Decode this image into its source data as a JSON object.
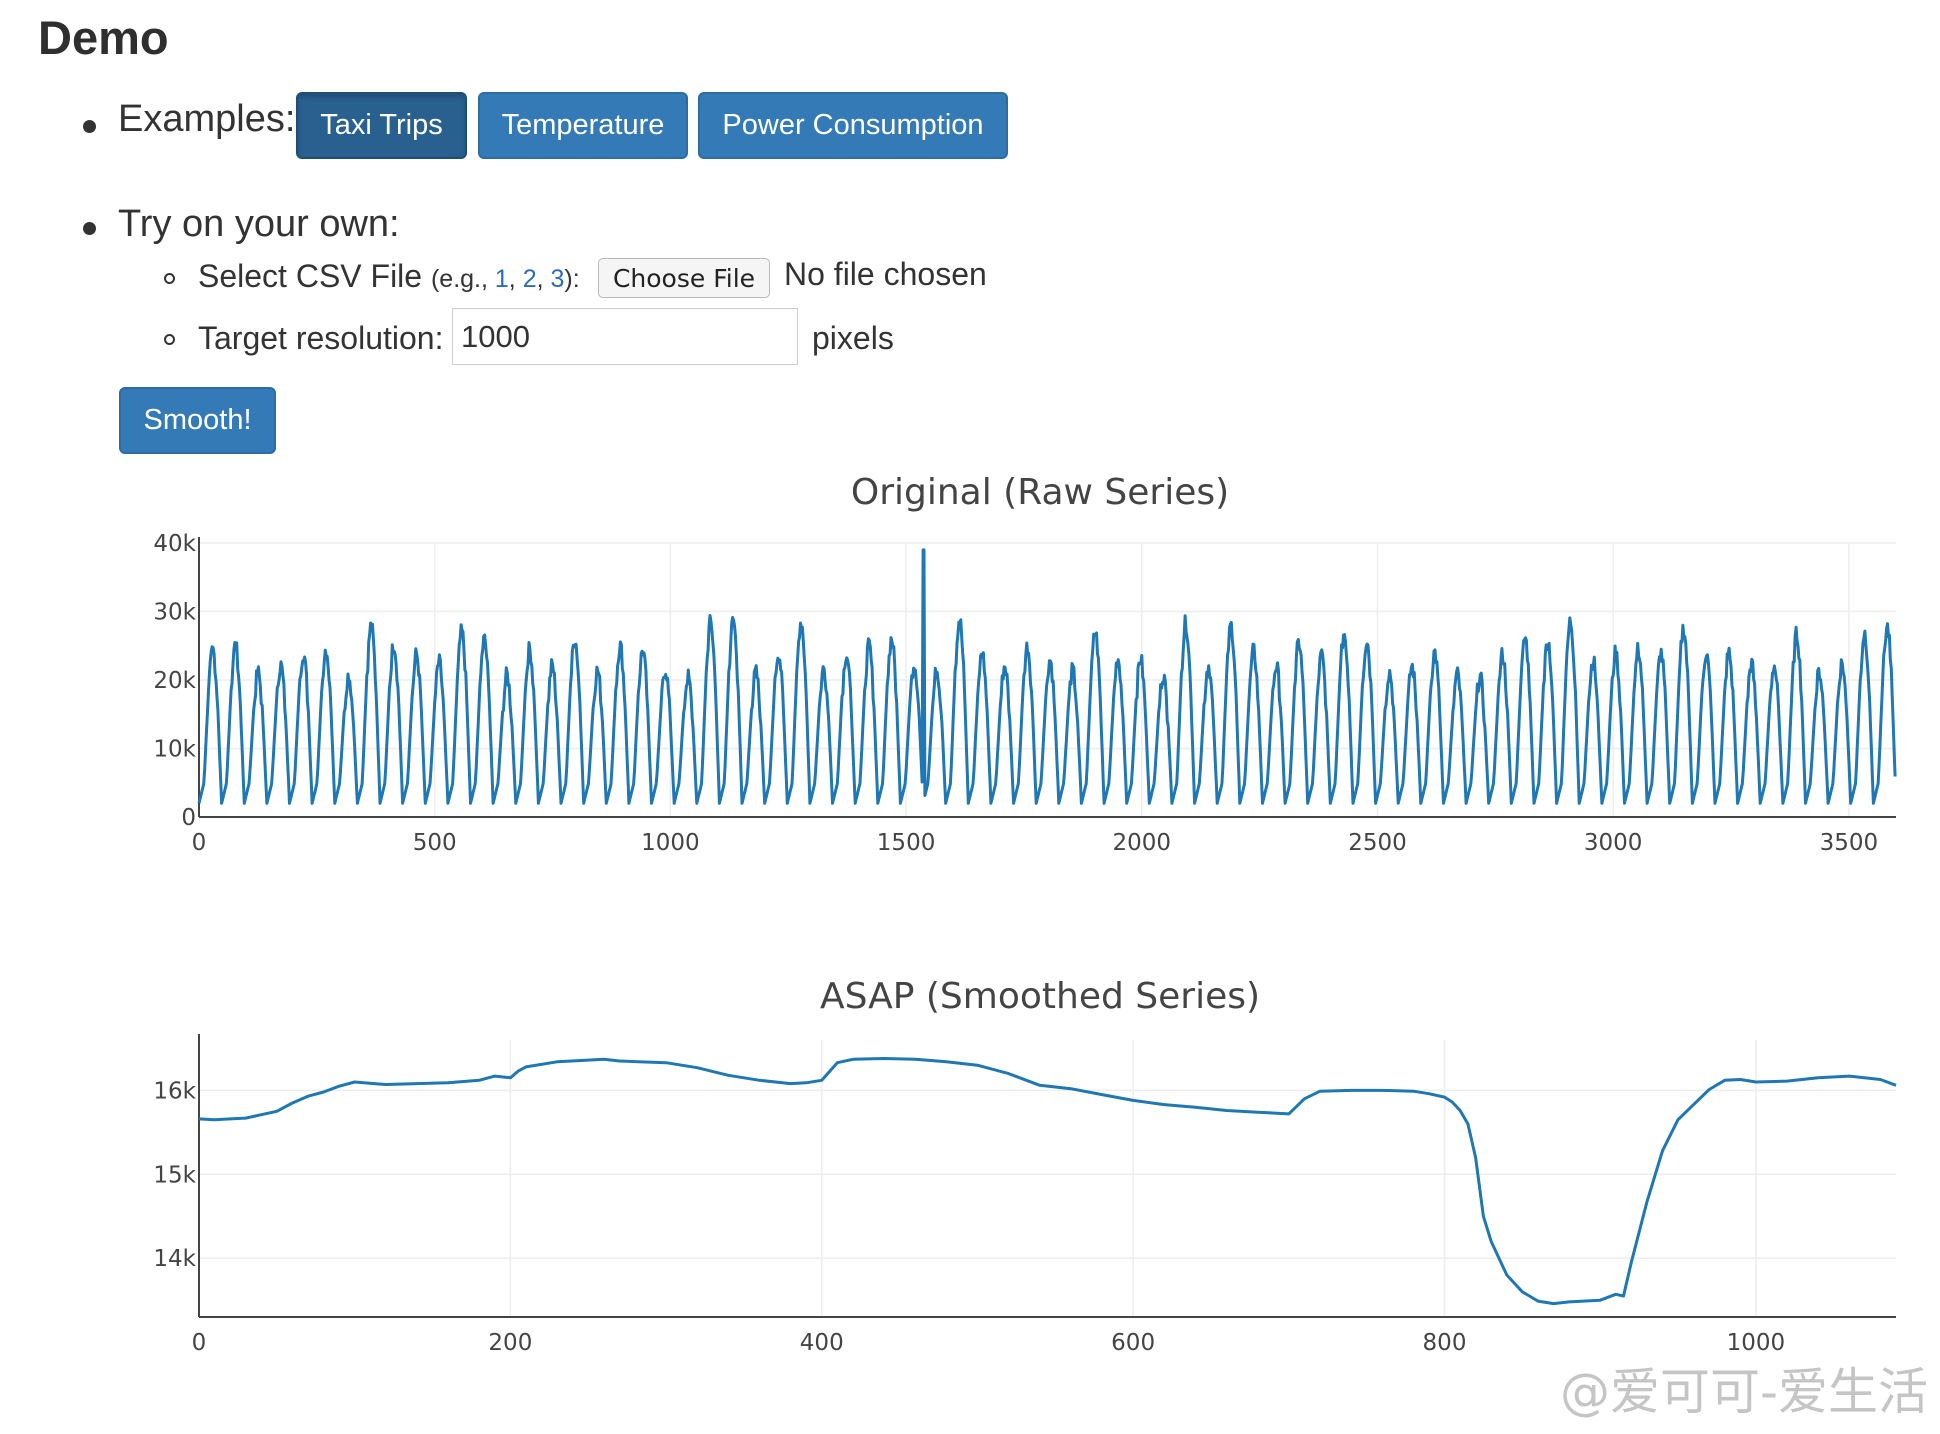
{
  "heading": "Demo",
  "examples": {
    "label": "Examples:",
    "buttons": [
      "Taxi Trips",
      "Temperature",
      "Power Consumption"
    ]
  },
  "own": {
    "label": "Try on your own:",
    "csv_label": "Select CSV File",
    "eg_prefix": "(e.g., ",
    "eg_links": [
      "1",
      "2",
      "3"
    ],
    "eg_suffix": "):",
    "choose_file": "Choose File",
    "no_file": "No file chosen",
    "resolution_label": "Target resolution:",
    "resolution_value": "1000",
    "pixels": "pixels"
  },
  "smooth_button": "Smooth!",
  "watermark": "@爱可可-爱生活",
  "colors": {
    "line": "#1f77b4",
    "button": "#337ab7",
    "button_active": "#286090",
    "link": "#2a6db8"
  },
  "chart_data": [
    {
      "type": "line",
      "title": "Original (Raw Series)",
      "xlim": [
        0,
        3600
      ],
      "ylim": [
        0,
        40000
      ],
      "xticks": [
        0,
        500,
        1000,
        1500,
        2000,
        2500,
        3000,
        3500
      ],
      "xtick_labels": [
        "0",
        "500",
        "1000",
        "1500",
        "2000",
        "2500",
        "3000",
        "3500"
      ],
      "yticks": [
        0,
        10000,
        20000,
        30000,
        40000
      ],
      "ytick_labels": [
        "0",
        "10k",
        "20k",
        "30k",
        "40k"
      ],
      "series": [
        {
          "n_points": 3600,
          "period": 48,
          "min": 2000,
          "peaks_range": [
            20000,
            29000
          ],
          "spike": {
            "x": 1537,
            "y": 39000
          },
          "x": [
            0,
            3600
          ],
          "y": [
            2000,
            39000
          ]
        }
      ]
    },
    {
      "type": "line",
      "title": "ASAP (Smoothed Series)",
      "xlim": [
        0,
        1090
      ],
      "ylim": [
        13300,
        16600
      ],
      "xticks": [
        0,
        200,
        400,
        600,
        800,
        1000
      ],
      "xtick_labels": [
        "0",
        "200",
        "400",
        "600",
        "800",
        "1000"
      ],
      "yticks": [
        14000,
        15000,
        16000
      ],
      "ytick_labels": [
        "14k",
        "15k",
        "16k"
      ],
      "series": [
        {
          "x": [
            0,
            10,
            20,
            30,
            40,
            50,
            60,
            70,
            80,
            90,
            100,
            120,
            140,
            160,
            180,
            190,
            200,
            205,
            210,
            230,
            250,
            260,
            270,
            300,
            320,
            340,
            360,
            380,
            390,
            400,
            410,
            420,
            440,
            460,
            480,
            500,
            520,
            540,
            560,
            580,
            600,
            620,
            640,
            660,
            680,
            700,
            710,
            720,
            740,
            760,
            780,
            790,
            800,
            805,
            810,
            815,
            820,
            825,
            830,
            840,
            850,
            860,
            870,
            880,
            900,
            910,
            915,
            920,
            930,
            940,
            950,
            960,
            970,
            980,
            990,
            1000,
            1020,
            1040,
            1060,
            1080,
            1090
          ],
          "y": [
            15660,
            15650,
            15660,
            15670,
            15710,
            15750,
            15850,
            15930,
            15980,
            16050,
            16100,
            16070,
            16080,
            16090,
            16120,
            16170,
            16150,
            16230,
            16280,
            16340,
            16360,
            16370,
            16350,
            16330,
            16270,
            16180,
            16120,
            16080,
            16090,
            16120,
            16330,
            16370,
            16380,
            16370,
            16340,
            16300,
            16200,
            16060,
            16020,
            15950,
            15880,
            15830,
            15800,
            15760,
            15740,
            15720,
            15900,
            15990,
            16000,
            16000,
            15990,
            15960,
            15920,
            15860,
            15760,
            15600,
            15200,
            14500,
            14200,
            13800,
            13600,
            13490,
            13460,
            13480,
            13500,
            13570,
            13550,
            13950,
            14670,
            15280,
            15650,
            15830,
            16010,
            16120,
            16130,
            16100,
            16110,
            16150,
            16170,
            16130,
            16060
          ]
        }
      ]
    }
  ]
}
